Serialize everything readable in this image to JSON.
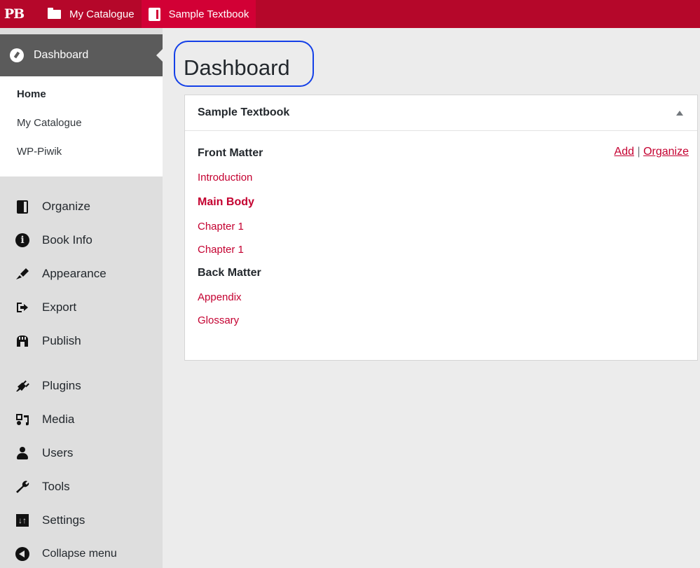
{
  "topbar": {
    "logo": "PB",
    "items": [
      {
        "label": "My Catalogue",
        "icon": "folder-icon"
      },
      {
        "label": "Sample Textbook",
        "icon": "book-icon"
      }
    ]
  },
  "sidebar": {
    "current": {
      "label": "Dashboard",
      "icon": "dashboard-icon"
    },
    "submenu": [
      {
        "label": "Home",
        "current": true
      },
      {
        "label": "My Catalogue"
      },
      {
        "label": "WP-Piwik"
      }
    ],
    "group1": [
      {
        "label": "Organize",
        "icon": "book-icon"
      },
      {
        "label": "Book Info",
        "icon": "info-icon"
      },
      {
        "label": "Appearance",
        "icon": "paintbrush-icon"
      },
      {
        "label": "Export",
        "icon": "export-icon"
      },
      {
        "label": "Publish",
        "icon": "store-icon"
      }
    ],
    "group2": [
      {
        "label": "Plugins",
        "icon": "plug-icon"
      },
      {
        "label": "Media",
        "icon": "media-icon"
      },
      {
        "label": "Users",
        "icon": "users-icon"
      },
      {
        "label": "Tools",
        "icon": "wrench-icon"
      },
      {
        "label": "Settings",
        "icon": "settings-icon"
      }
    ],
    "collapse": {
      "label": "Collapse menu",
      "icon": "collapse-icon"
    }
  },
  "main": {
    "title": "Dashboard",
    "panel": {
      "title": "Sample Textbook",
      "actions": {
        "add": "Add",
        "separator": "|",
        "organize": "Organize"
      },
      "rows": [
        {
          "label": "Front Matter",
          "type": "section"
        },
        {
          "label": "Introduction",
          "type": "link"
        },
        {
          "label": "Main Body",
          "type": "link-bold"
        },
        {
          "label": "Chapter 1",
          "type": "link"
        },
        {
          "label": "Chapter 1",
          "type": "link"
        },
        {
          "label": "Back Matter",
          "type": "section"
        },
        {
          "label": "Appendix",
          "type": "link"
        },
        {
          "label": "Glossary",
          "type": "link"
        }
      ]
    }
  },
  "colors": {
    "brand": "#b5072a",
    "brand_active": "#d20035",
    "link": "#c40030",
    "highlight": "#1440e8"
  }
}
